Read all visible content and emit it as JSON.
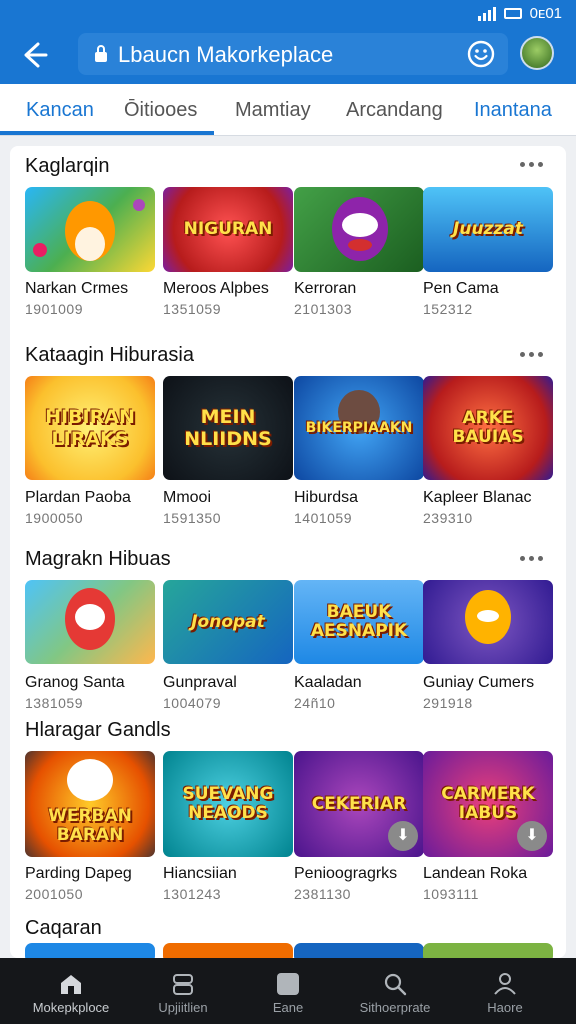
{
  "status": {
    "time": "0ᴇ01"
  },
  "header": {
    "search_text": "Lbaucn Makorkeplace",
    "back_icon": "arrow-left-icon",
    "emoji_icon": "smiley-icon",
    "avatar_icon": "user-avatar"
  },
  "tabs": [
    {
      "label": "Kancan"
    },
    {
      "label": "Ōitiooes"
    },
    {
      "label": "Mamtiay"
    },
    {
      "label": "Arcandang"
    },
    {
      "label": "Inantana"
    }
  ],
  "sections": [
    {
      "title": "Kaglarqin",
      "games": [
        {
          "name": "Narkan Crmes",
          "count": "1901009"
        },
        {
          "name": "Meroos Alpbes",
          "count": "1351059"
        },
        {
          "name": "Kerroran",
          "count": "2101303"
        },
        {
          "name": "Pen Cama",
          "count": "152312"
        }
      ]
    },
    {
      "title": "Kataagin Hiburasia",
      "games": [
        {
          "name": "Plardan Paoba",
          "count": "1900050"
        },
        {
          "name": "Mmooi",
          "count": "1591350"
        },
        {
          "name": "Hiburdsa",
          "count": "1401059"
        },
        {
          "name": "Kapleer Blanac",
          "count": "239310"
        }
      ]
    },
    {
      "title": "Magrakn Hibuas",
      "games": [
        {
          "name": "Granog Santa",
          "count": "1381059"
        },
        {
          "name": "Gunpraval",
          "count": "1004079"
        },
        {
          "name": "Kaaladan",
          "count": "24ñ10"
        },
        {
          "name": "Guniay Cumers",
          "count": "291918"
        }
      ]
    },
    {
      "title": "Hlaragar Gandls",
      "games": [
        {
          "name": "Parding Dapeg",
          "count": "2001050"
        },
        {
          "name": "Hiancsiian",
          "count": "1301243"
        },
        {
          "name": "Penioogragrks",
          "count": "2381130"
        },
        {
          "name": "Landean Roka",
          "count": "1093111"
        }
      ]
    },
    {
      "title": "Caqaran"
    }
  ],
  "tile_text": {
    "s1g2": "NIGURAN",
    "s1g4": "Juuzzat",
    "s2g1": "HIBIRAN LIRAKS",
    "s2g2": "MEIN NLIIDNS",
    "s2g3": "BIKERPIAAKN",
    "s2g4": "ARKE BAUIAS",
    "s3g2": "Jonopat",
    "s3g3": "BAEUK AESNAPIK",
    "s4g1": "WERBAN BARAN",
    "s4g2": "SUEVANG NEAODS",
    "s4g3": "CEKERIAR",
    "s4g4": "CARMERK IABUS"
  },
  "bottom_nav": [
    {
      "label": "Mokepkploce",
      "icon": "home-icon"
    },
    {
      "label": "Upjiitlien",
      "icon": "library-icon"
    },
    {
      "label": "Eane",
      "icon": "square-icon"
    },
    {
      "label": "Sithoerprate",
      "icon": "search-icon"
    },
    {
      "label": "Haore",
      "icon": "profile-icon"
    }
  ],
  "colors": {
    "primary": "#1976d2",
    "nav_bg": "#15171a"
  }
}
